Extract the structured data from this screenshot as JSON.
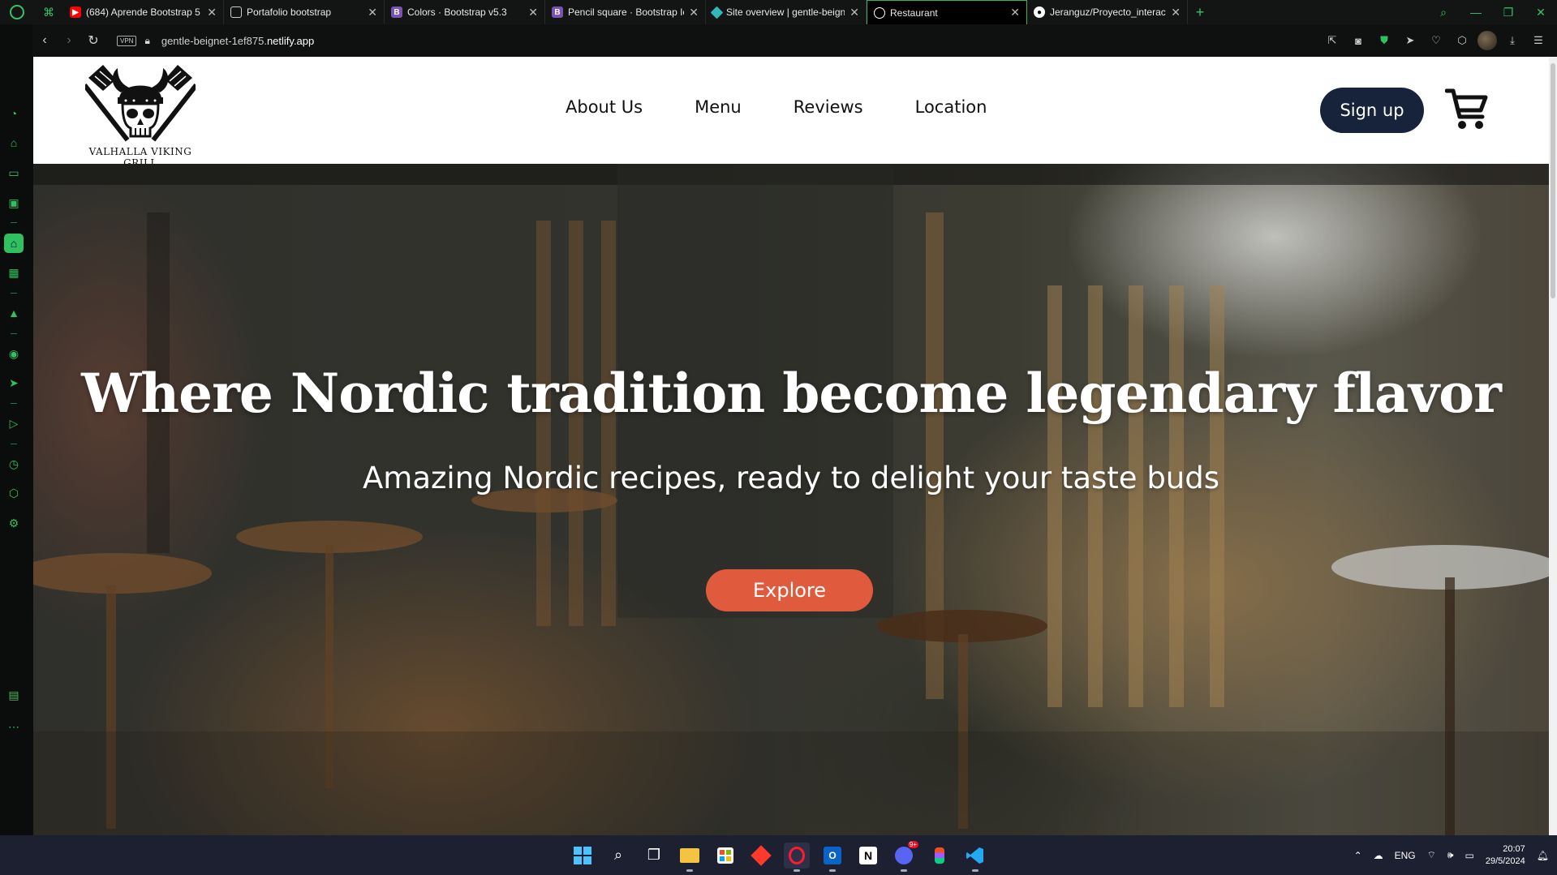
{
  "browser": {
    "tabs": [
      {
        "title": "(684) Aprende Bootstrap 5",
        "favicon": "youtube-icon",
        "color": "#ff0000"
      },
      {
        "title": "Portafolio bootstrap",
        "favicon": "page-icon",
        "color": "#cccccc"
      },
      {
        "title": "Colors · Bootstrap v5.3",
        "favicon": "bootstrap-icon",
        "color": "#7952b3"
      },
      {
        "title": "Pencil square · Bootstrap Icons",
        "favicon": "bootstrap-icon",
        "color": "#7952b3"
      },
      {
        "title": "Site overview | gentle-beignet",
        "favicon": "netlify-icon",
        "color": "#32b6b9"
      },
      {
        "title": "Restaurant",
        "favicon": "globe-icon",
        "color": "#ffffff",
        "active": true
      },
      {
        "title": "Jeranguz/Proyecto_interactivo",
        "favicon": "github-icon",
        "color": "#ffffff"
      }
    ],
    "vpn_label": "VPN",
    "url_prefix": "gentle-beignet-1ef875.",
    "url_domain": "netlify.app",
    "accent": "#2fc061"
  },
  "site": {
    "logo_text": "VALHALLA VIKING GRILL",
    "nav": [
      "About Us",
      "Menu",
      "Reviews",
      "Location"
    ],
    "signup_label": "Sign up",
    "hero_title": "Where Nordic tradition become legendary flavor",
    "hero_subtitle": "Amazing Nordic recipes, ready to delight your taste buds",
    "explore_label": "Explore",
    "colors": {
      "navy": "#16233a",
      "accent": "#e05a3e"
    }
  },
  "taskbar": {
    "apps": [
      "windows-start-icon",
      "search-icon",
      "task-view-icon",
      "file-explorer-icon",
      "store-icon",
      "app-icon",
      "opera-icon",
      "outlook-icon",
      "notion-icon",
      "discord-icon",
      "figma-icon",
      "vscode-icon"
    ],
    "discord_badge": "9+",
    "language": "ENG",
    "time": "20:07",
    "date": "29/5/2024"
  }
}
